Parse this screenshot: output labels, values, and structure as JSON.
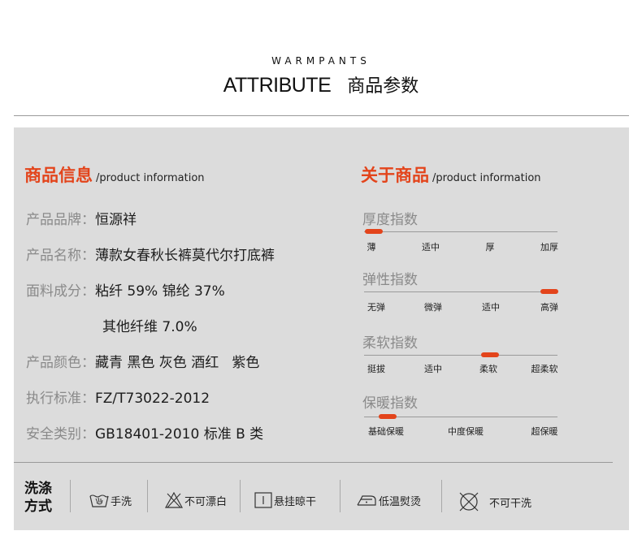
{
  "header": {
    "brand": "WARMPANTS",
    "title_en": "ATTRIBUTE",
    "title_cn": "商品参数"
  },
  "product_info": {
    "heading_cn": "商品信息",
    "heading_en": "/product information",
    "rows": [
      {
        "label": "产品品牌：",
        "value": "恒源祥"
      },
      {
        "label": "产品名称：",
        "value": "薄款女春秋长裤莫代尔打底裤"
      },
      {
        "label": "面料成分：",
        "value": "粘纤 59% 锦纶 37%"
      },
      {
        "label": "",
        "value": "其他纤维 7.0%"
      },
      {
        "label": "产品颜色：",
        "value": "藏青 黑色 灰色 酒红   紫色"
      },
      {
        "label": "执行标准：",
        "value": "FZ/T73022-2012"
      },
      {
        "label": "安全类别：",
        "value": "GB18401-2010 标准 B 类"
      }
    ]
  },
  "about": {
    "heading_cn": "关于商品",
    "heading_en": "/product information",
    "meters": [
      {
        "title": "厚度指数",
        "ticks": [
          "薄",
          "适中",
          "厚",
          "加厚"
        ],
        "level": 0.05
      },
      {
        "title": "弹性指数",
        "ticks": [
          "无弹",
          "微弹",
          "适中",
          "高弹"
        ],
        "level": 0.96
      },
      {
        "title": "柔软指数",
        "ticks": [
          "挺拔",
          "适中",
          "柔软",
          "超柔软"
        ],
        "level": 0.65
      },
      {
        "title": "保暖指数",
        "ticks": [
          "基础保暖",
          "中度保暖",
          "超保暖"
        ],
        "level": 0.12
      }
    ]
  },
  "washing": {
    "title_line1": "洗涤",
    "title_line2": "方式",
    "items": [
      {
        "icon": "hand-wash-icon",
        "label": "手洗"
      },
      {
        "icon": "no-bleach-icon",
        "label": "不可漂白"
      },
      {
        "icon": "hang-dry-icon",
        "label": "悬挂晾干"
      },
      {
        "icon": "low-iron-icon",
        "label": "低温熨烫"
      },
      {
        "icon": "no-dry-clean-icon",
        "label": "不可干洗"
      }
    ]
  },
  "colors": {
    "accent": "#e3441b",
    "panel": "#dcdcdc",
    "muted_text": "#8a8a8a"
  }
}
